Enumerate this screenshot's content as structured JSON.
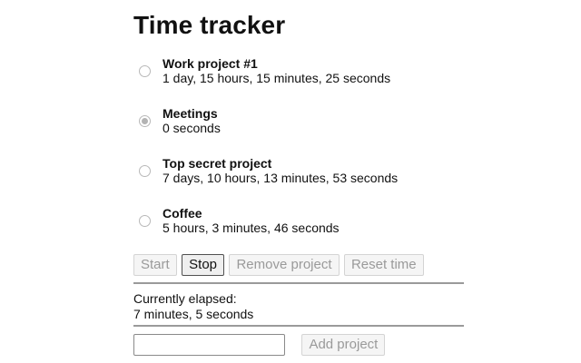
{
  "title": "Time tracker",
  "projects": [
    {
      "name": "Work project #1",
      "time": "1 day, 15 hours, 15 minutes, 25 seconds",
      "selected": false
    },
    {
      "name": "Meetings",
      "time": "0 seconds",
      "selected": true
    },
    {
      "name": "Top secret project",
      "time": "7 days, 10 hours, 13 minutes, 53 seconds",
      "selected": false
    },
    {
      "name": "Coffee",
      "time": "5 hours, 3 minutes, 46 seconds",
      "selected": false
    }
  ],
  "controls": {
    "start_label": "Start",
    "stop_label": "Stop",
    "remove_label": "Remove project",
    "reset_label": "Reset time"
  },
  "elapsed": {
    "label": "Currently elapsed:",
    "value": "7 minutes, 5 seconds"
  },
  "add_project": {
    "input_value": "",
    "button_label": "Add project"
  }
}
